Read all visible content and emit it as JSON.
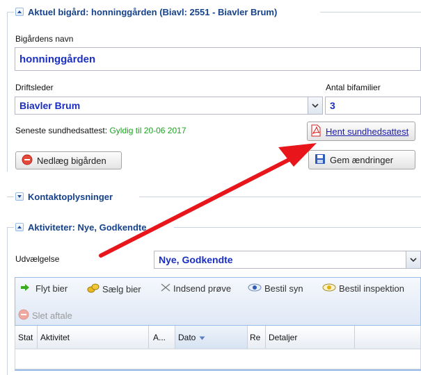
{
  "section_current": {
    "title": "Aktuel bigård: honninggården (Biavl: 2551 - Biavler Brum)"
  },
  "form": {
    "name_label": "Bigårdens navn",
    "name_value": "honninggården",
    "manager_label": "Driftsleder",
    "manager_value": "Biavler Brum",
    "colonies_label": "Antal bifamilier",
    "colonies_value": "3",
    "health_label": "Seneste sundhedsattest:",
    "health_status": "Gyldig til 20-06 2017",
    "fetch_certificate": "Hent sundhedsattest",
    "close_apiary": "Nedlæg bigården",
    "save_changes": "Gem ændringer"
  },
  "section_contact": {
    "title": "Kontaktoplysninger"
  },
  "section_activities": {
    "title": "Aktiviteter: Nye, Godkendte",
    "selection_label": "Udvælgelse",
    "selection_value": "Nye, Godkendte"
  },
  "toolbar": {
    "move_bees": "Flyt bier",
    "sell_bees": "Sælg bier",
    "send_sample": "Indsend prøve",
    "order_inspection_view": "Bestil syn",
    "order_inspection": "Bestil inspektion",
    "delete_agreement": "Slet aftale"
  },
  "grid": {
    "columns": [
      "Stat",
      "Aktivitet",
      "A...",
      "Dato",
      "Re",
      "Detaljer"
    ]
  },
  "colors": {
    "legend_blue": "#15428b",
    "value_blue": "#1b2ec2",
    "valid_green": "#1aa320",
    "arrow_red": "#e8161b"
  }
}
